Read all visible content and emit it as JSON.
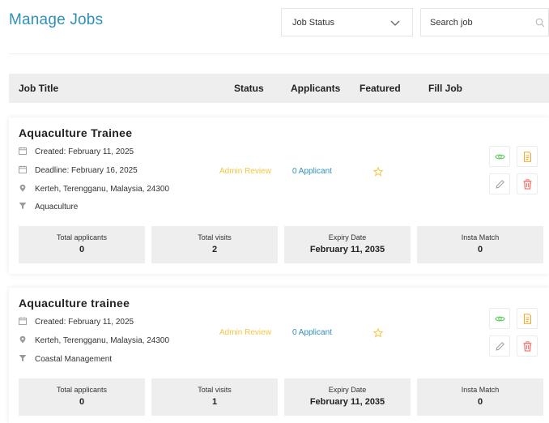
{
  "header": {
    "title": "Manage Jobs",
    "status_filter": "Job Status",
    "search_placeholder": "Search job"
  },
  "table": {
    "columns": [
      "Job Title",
      "Status",
      "Applicants",
      "Featured",
      "Fill Job"
    ]
  },
  "jobs": [
    {
      "title": "Aquaculture Trainee",
      "created": "Created: February 11, 2025",
      "deadline": "Deadline: February 16, 2025",
      "location": "Kerteh, Terengganu, Malaysia, 24300",
      "category": "Aquaculture",
      "status": "Admin Review",
      "applicants": "0 Applicant",
      "featured": false,
      "stats": [
        {
          "label": "Total applicants",
          "value": "0"
        },
        {
          "label": "Total visits",
          "value": "2"
        },
        {
          "label": "Expiry Date",
          "value": "February 11, 2035"
        },
        {
          "label": "Insta Match",
          "value": "0"
        }
      ]
    },
    {
      "title": "Aquaculture trainee",
      "created": "Created: February 11, 2025",
      "location": "Kerteh, Terengganu, Malaysia, 24300",
      "category": "Coastal Management",
      "status": "Admin Review",
      "applicants": "0 Applicant",
      "featured": false,
      "stats": [
        {
          "label": "Total applicants",
          "value": "0"
        },
        {
          "label": "Total visits",
          "value": "1"
        },
        {
          "label": "Expiry Date",
          "value": "February 11, 2035"
        },
        {
          "label": "Insta Match",
          "value": "0"
        }
      ]
    }
  ],
  "icons": {
    "calendar": "calendar-icon",
    "location": "location-pin-icon",
    "category": "filter-icon",
    "star": "star-outline-icon",
    "view": "eye-icon",
    "document": "document-icon",
    "edit": "pencil-icon",
    "delete": "trash-icon",
    "chevron": "chevron-down-icon",
    "search": "search-icon"
  },
  "colors": {
    "title": "#2f8fb8",
    "status": "#f5c542",
    "link": "#2f8fb8",
    "view": "#5cc95c",
    "document": "#f5a623",
    "delete": "#f0625a",
    "edit": "#9a9a9a"
  }
}
